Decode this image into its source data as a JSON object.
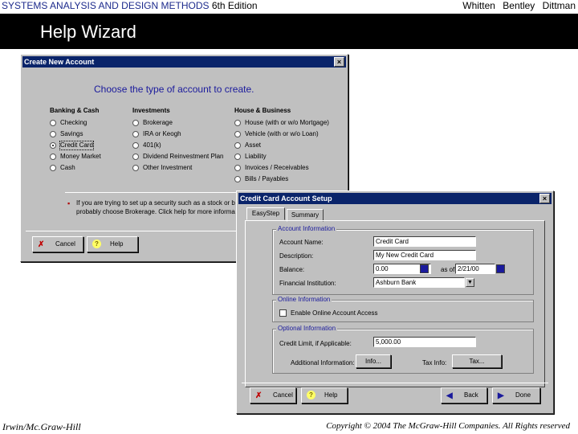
{
  "slide": {
    "header_left": "SYSTEMS ANALYSIS AND DESIGN METHODS",
    "header_edition": "6th Edition",
    "authors": [
      "Whitten",
      "Bentley",
      "Dittman"
    ],
    "title": "Help Wizard",
    "footer_left": "Irwin/Mc.Graw-Hill",
    "footer_right": "Copyright © 2004 The McGraw-Hill Companies. All Rights reserved"
  },
  "create_dialog": {
    "title": "Create New Account",
    "close_glyph": "×",
    "prompt": "Choose the type of account to create.",
    "groups": [
      {
        "heading": "Banking & Cash",
        "options": [
          "Checking",
          "Savings",
          "Credit Card",
          "Money Market",
          "Cash"
        ]
      },
      {
        "heading": "Investments",
        "options": [
          "Brokerage",
          "IRA or Keogh",
          "401(k)",
          "Dividend Reinvestment Plan",
          "Other Investment"
        ]
      },
      {
        "heading": "House & Business",
        "options": [
          "House (with or w/o Mortgage)",
          "Vehicle (with or w/o Loan)",
          "Asset",
          "Liability",
          "Invoices / Receivables",
          "Bills / Payables"
        ]
      }
    ],
    "selected": "Credit Card",
    "note_line1": "If you are trying to set up a security such as a stock or b",
    "note_line2": "probably choose Brokerage. Click help for more informa",
    "buttons": {
      "cancel": "Cancel",
      "help": "Help"
    }
  },
  "setup_dialog": {
    "title": "Credit Card Account Setup",
    "close_glyph": "×",
    "tabs": [
      "EasyStep",
      "Summary"
    ],
    "account_info": {
      "legend": "Account Information",
      "labels": {
        "name": "Account Name:",
        "description": "Description:",
        "balance": "Balance:",
        "as_of": "as of",
        "institution": "Financial Institution:"
      },
      "values": {
        "name": "Credit Card",
        "description": "My New Credit Card",
        "balance": "0.00",
        "as_of": "2/21/00",
        "institution": "Ashburn Bank"
      }
    },
    "online_info": {
      "legend": "Online Information",
      "checkbox_label": "Enable Online Account Access"
    },
    "optional_info": {
      "legend": "Optional Information",
      "credit_limit_label": "Credit Limit, if Applicable:",
      "credit_limit_value": "5,000.00",
      "additional_label": "Additional Information:",
      "info_button": "Info...",
      "tax_label": "Tax Info:",
      "tax_button": "Tax..."
    },
    "buttons": {
      "cancel": "Cancel",
      "help": "Help",
      "back": "Back",
      "done": "Done"
    }
  },
  "colors": {
    "band": "#000000",
    "title_bar": "#0a246a",
    "dialog_face": "#c0c0c0",
    "accent_text": "#1a1a9c"
  }
}
